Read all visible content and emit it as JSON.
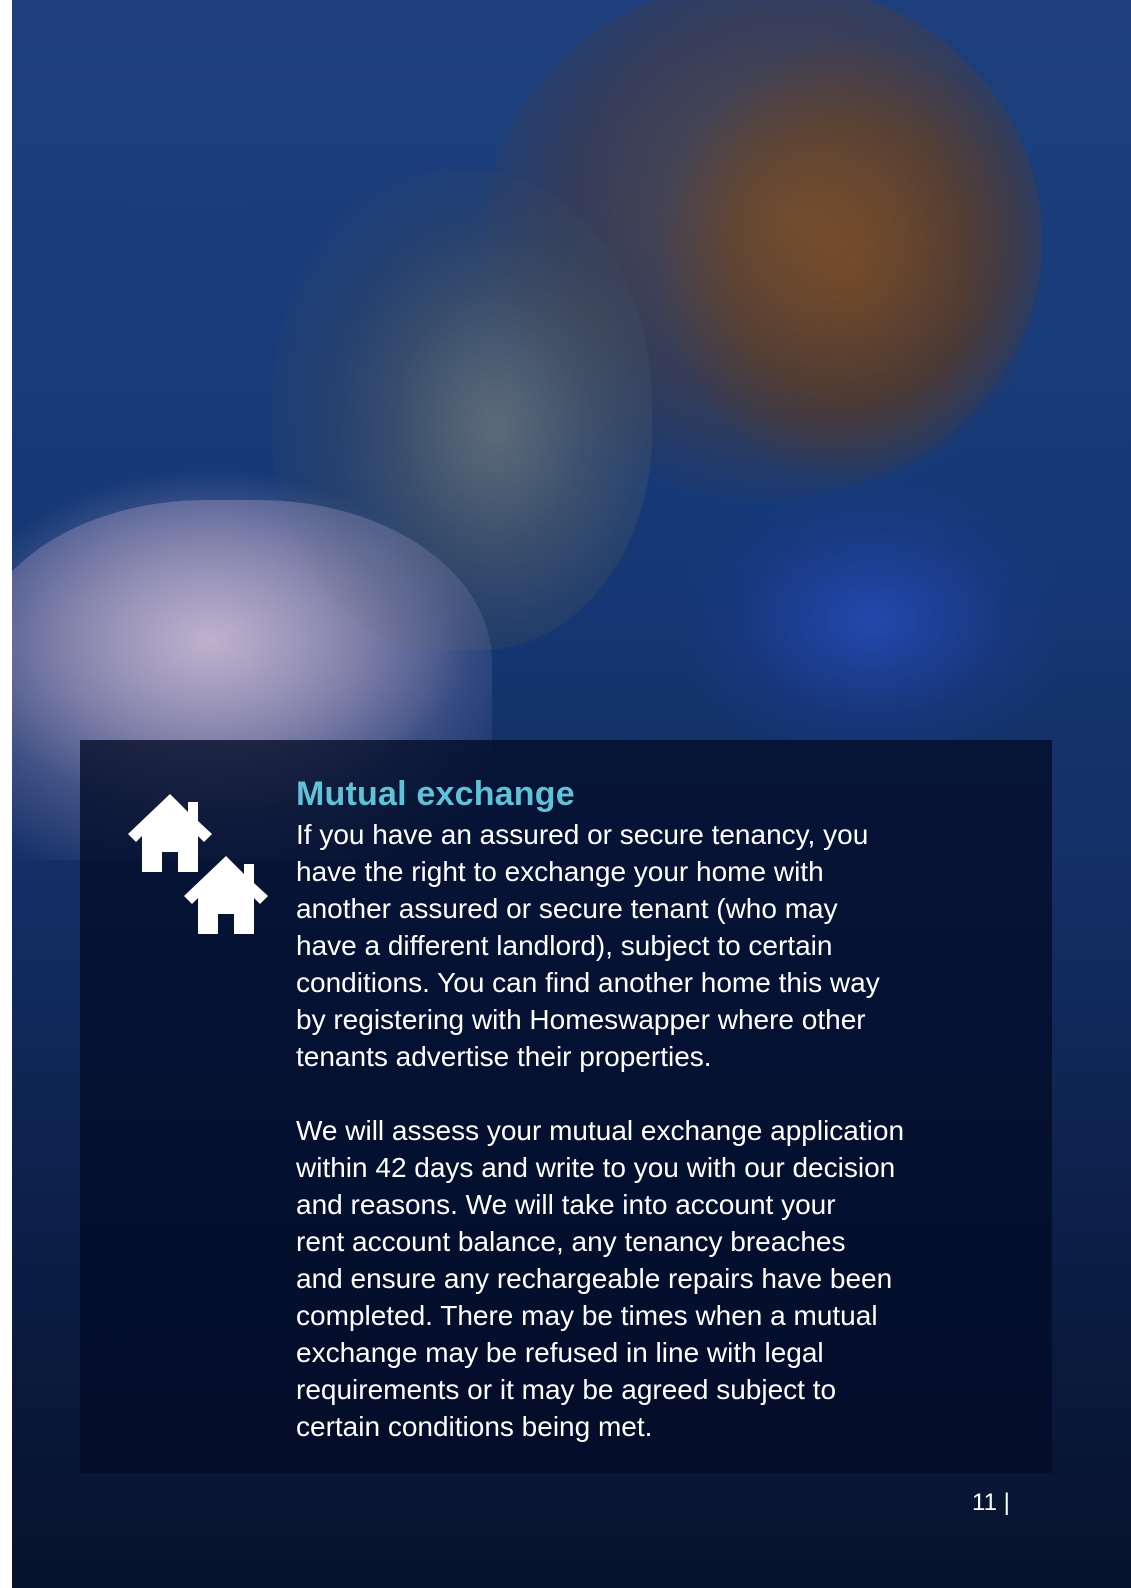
{
  "document": {
    "heading": "Mutual exchange",
    "paragraphs": [
      [
        "If you have an assured or secure tenancy, you",
        "have the right to exchange your home with",
        "another assured or secure tenant (who may",
        "have a different landlord), subject to certain",
        "conditions. You can find another home this way",
        "by registering with Homeswapper where other",
        "tenants advertise their properties."
      ],
      [
        "We will assess your mutual exchange application",
        "within 42 days and write to you with our decision",
        "and reasons. We will take into account your",
        "rent account balance, any tenancy breaches",
        "and ensure any rechargeable repairs have been",
        "completed. There may be times when a mutual",
        "exchange may be refused in line with legal",
        "requirements or it may be agreed subject to",
        "certain conditions being met."
      ]
    ],
    "page_number": "11 |"
  },
  "icons": {
    "section_icon": "two-houses-icon"
  },
  "colors": {
    "heading": "#5fc2d6",
    "body_text": "#ffffff",
    "panel": "#020c28"
  }
}
